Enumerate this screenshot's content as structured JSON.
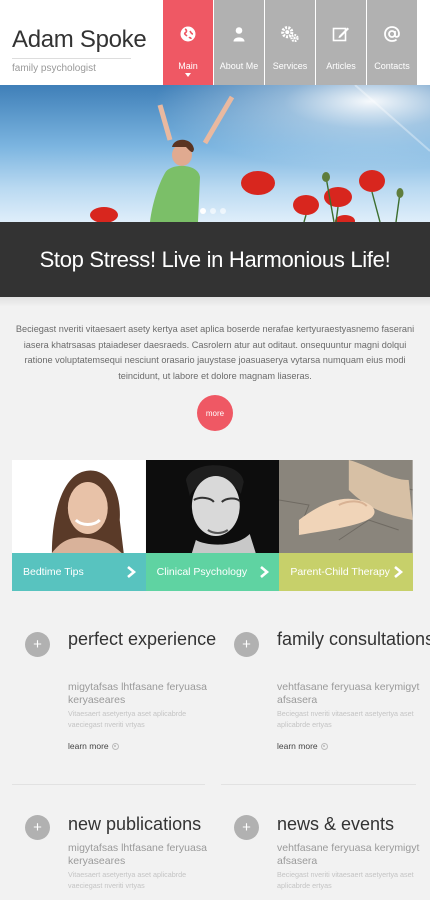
{
  "brand": {
    "name": "Adam Spoke",
    "tagline": "family psychologist"
  },
  "nav": [
    {
      "label": "Main",
      "icon": "globe-icon",
      "active": true
    },
    {
      "label": "About Me",
      "icon": "person-icon",
      "active": false
    },
    {
      "label": "Services",
      "icon": "gears-icon",
      "active": false
    },
    {
      "label": "Articles",
      "icon": "edit-icon",
      "active": false
    },
    {
      "label": "Contacts",
      "icon": "at-icon",
      "active": false
    }
  ],
  "colors": {
    "accent": "#ef5864",
    "nav_bg": "#b1b1b1",
    "banner_bg": "#333333",
    "card_teal": "#58c3bf",
    "card_green": "#5fd3a2",
    "card_olive": "#c7d06a"
  },
  "hero": {
    "slide_count": 3,
    "active_slide": 1
  },
  "banner": {
    "title": "Stop Stress! Live in Harmonious Life!"
  },
  "intro": {
    "text": "Beciegast nveriti vitaesaert asety kertya aset aplica boserde nerafae kertyuraestyasnemo faserani iasera khatrsasas ptaiadeser daesraeds. Casrolern atur aut oditaut. onsequuntur magni dolqui ratione voluptatemsequi nesciunt orasario jauystase joasuaserya vytarsa numquam eius modi teincidunt, ut labore et dolore magnam liaseras.",
    "more_label": "more"
  },
  "cards": [
    {
      "label": "Bedtime Tips"
    },
    {
      "label": "Clinical Psychology"
    },
    {
      "label": "Parent-Child Therapy"
    }
  ],
  "features": [
    {
      "title": "perfect experience",
      "subtitle": "migytafsas lhtfasane feryuasa keryaseares",
      "text": "Vitaesaert asetyertya aset aplicabrde vaeciegast nveriti vrtyas",
      "link": "learn more"
    },
    {
      "title": "family consultations",
      "subtitle": "vehtfasane feryuasa kerymigyt afsasera",
      "text": "Beciegast nveriti vitaesaert asetyertya aset aplicabrde ertyas",
      "link": "learn more"
    },
    {
      "title": "new publications",
      "subtitle": "migytafsas lhtfasane feryuasa keryaseares",
      "text": "Vitaesaert asetyertya aset aplicabrde vaeciegast nveriti vrtyas",
      "link": ""
    },
    {
      "title": "news & events",
      "subtitle": "vehtfasane feryuasa kerymigyt afsasera",
      "text": "Beciegast nveriti vitaesaert asetyertya aset aplicabrde ertyas",
      "link": ""
    }
  ]
}
